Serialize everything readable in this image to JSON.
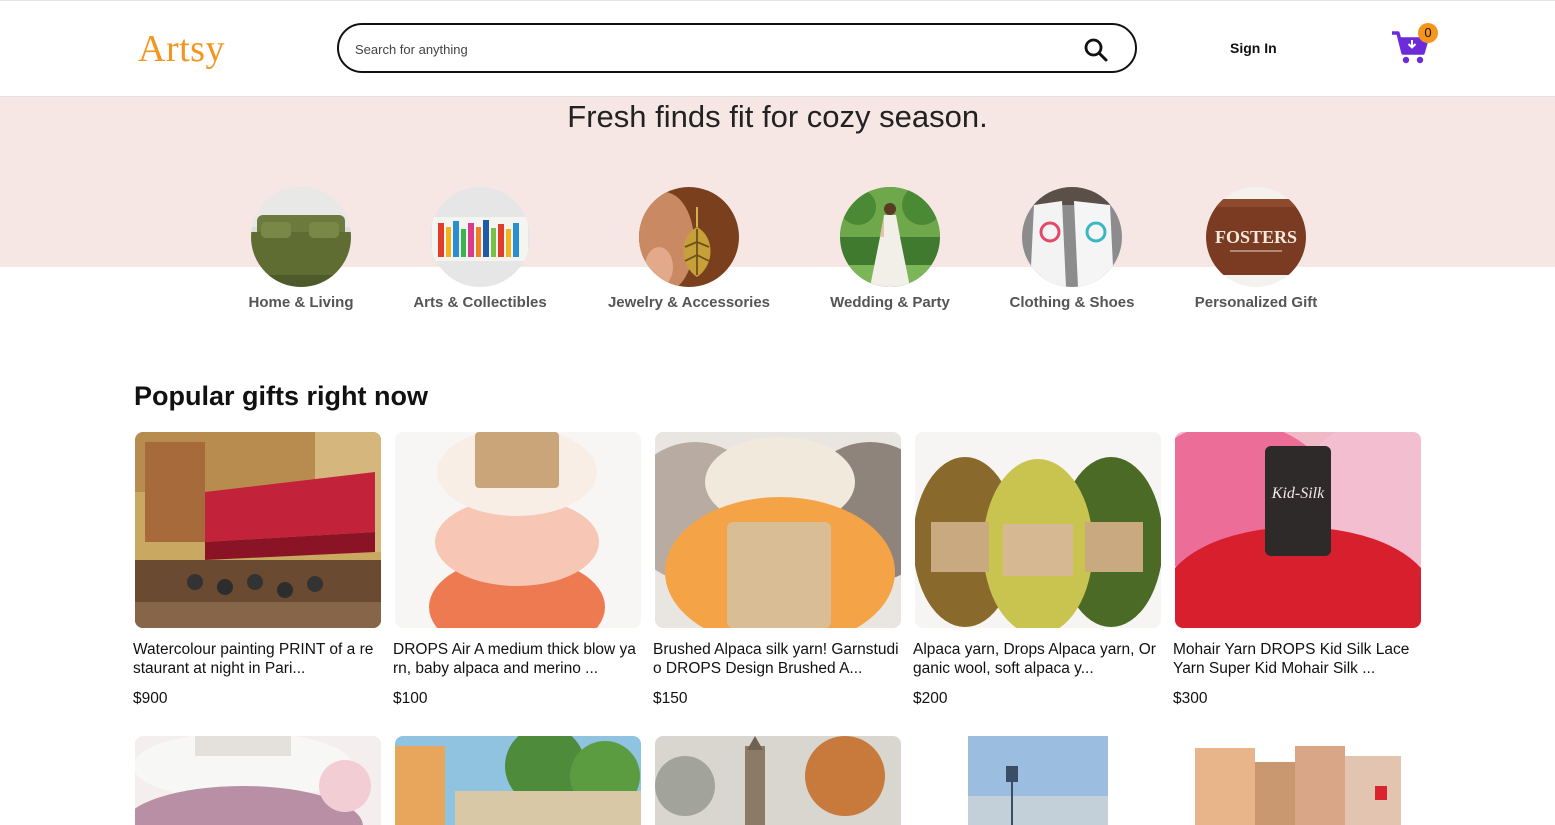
{
  "header": {
    "logo": "Artsy",
    "search_placeholder": "Search for anything",
    "sign_in": "Sign In",
    "cart_count": "0"
  },
  "hero": {
    "title": "Fresh finds fit for cozy season."
  },
  "categories": [
    {
      "label": "Home & Living",
      "icon": "bed-image"
    },
    {
      "label": "Arts & Collectibles",
      "icon": "painting-image"
    },
    {
      "label": "Jewelry & Accessories",
      "icon": "earring-image"
    },
    {
      "label": "Wedding & Party",
      "icon": "bride-image"
    },
    {
      "label": "Clothing & Shoes",
      "icon": "shirt-image"
    },
    {
      "label": "Personalized Gift",
      "icon": "sign-image"
    }
  ],
  "section": {
    "title": "Popular gifts right now"
  },
  "products": [
    {
      "title": "Watercolour painting PRINT of a restaurant at night in Pari...",
      "price": "$900"
    },
    {
      "title": "DROPS Air A medium thick blow yarn, baby alpaca and merino ...",
      "price": "$100"
    },
    {
      "title": "Brushed Alpaca silk yarn! Garnstudio DROPS Design Brushed A...",
      "price": "$150"
    },
    {
      "title": "Alpaca yarn, Drops Alpaca yarn, Organic wool, soft alpaca y...",
      "price": "$200"
    },
    {
      "title": "Mohair Yarn DROPS Kid Silk Lace Yarn Super Kid Mohair Silk ...",
      "price": "$300"
    }
  ],
  "colors": {
    "brand": "#f5951e",
    "cart": "#6c2bd9",
    "hero_bg": "#f6e7e4"
  }
}
